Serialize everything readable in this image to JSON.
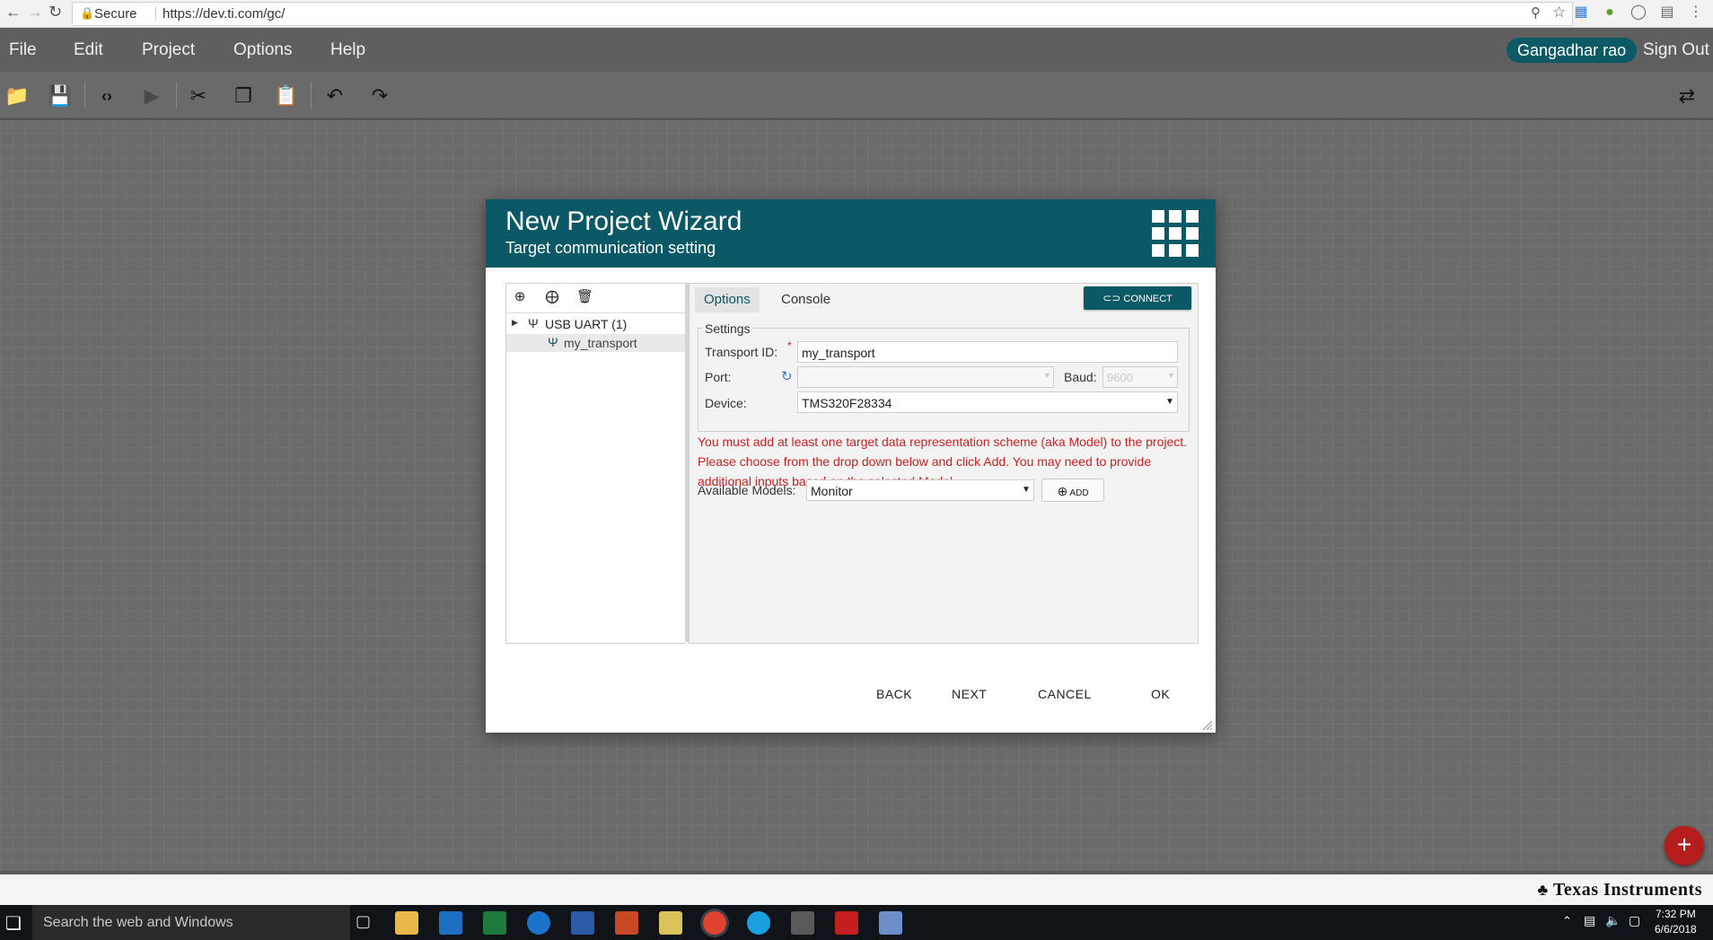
{
  "browser": {
    "secure_label": "Secure",
    "url": "https://dev.ti.com/gc/"
  },
  "menubar": {
    "items": [
      "File",
      "Edit",
      "Project",
      "Options",
      "Help"
    ],
    "user": "Gangadhar rao",
    "signout": "Sign Out"
  },
  "toolbar": {
    "icons": [
      "open-folder-icon",
      "save-icon",
      "code-view-icon",
      "run-icon",
      "cut-icon",
      "copy-icon",
      "paste-icon",
      "undo-icon",
      "redo-icon",
      "swap-icon"
    ]
  },
  "dialog": {
    "title": "New Project Wizard",
    "subtitle": "Target communication setting",
    "tree": {
      "group_label": "USB UART (1)",
      "child_label": "my_transport"
    },
    "tabs": {
      "options": "Options",
      "console": "Console"
    },
    "connect_label": "CONNECT",
    "settings": {
      "legend": "Settings",
      "transport_id_label": "Transport ID:",
      "required_mark": "*",
      "transport_id_value": "my_transport",
      "port_label": "Port:",
      "port_value": "",
      "baud_label": "Baud:",
      "baud_value": "9600",
      "device_label": "Device:",
      "device_value": "TMS320F28334"
    },
    "warning": "You must add at least one target data representation scheme (aka Model) to the project. Please choose from the drop down below and click Add. You may need to provide additional inputs based on the selected Model.",
    "models_label": "Available Models:",
    "models_value": "Monitor",
    "add_label": "ADD",
    "buttons": {
      "back": "BACK",
      "next": "NEXT",
      "cancel": "CANCEL",
      "ok": "OK"
    }
  },
  "footer": {
    "brand": "Texas Instruments"
  },
  "taskbar": {
    "search_placeholder": "Search the web and Windows",
    "time": "7:32 PM",
    "date": "6/6/2018"
  },
  "colors": {
    "header": "#0b5866",
    "warning": "#d02020",
    "fab": "#b51d1d"
  }
}
